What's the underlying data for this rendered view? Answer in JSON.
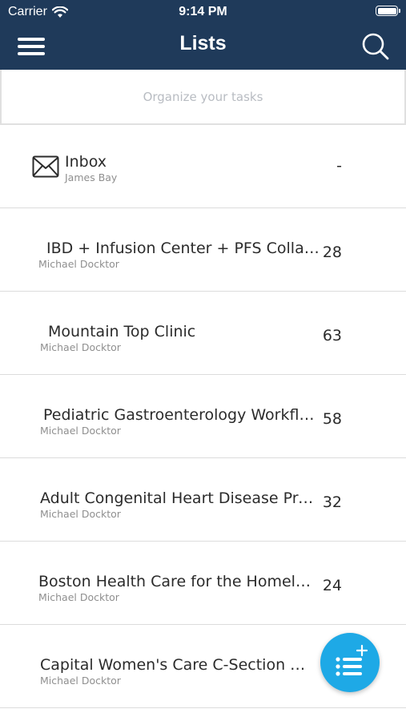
{
  "status_bar": {
    "carrier": "Carrier",
    "time": "9:14 PM"
  },
  "header": {
    "title": "Lists",
    "menu_icon": "hamburger-menu-icon",
    "search_icon": "search-icon",
    "background": "#1f3a5a"
  },
  "search": {
    "placeholder": "Organize your tasks",
    "value": ""
  },
  "lists": [
    {
      "title": "Inbox",
      "owner": "James Bay",
      "count": "-",
      "icon": "envelope-icon"
    },
    {
      "title": "IBD + Infusion Center + PFS Collaborat...",
      "owner": "Michael Docktor",
      "count": "28"
    },
    {
      "title": "Mountain Top Clinic",
      "owner": "Michael Docktor",
      "count": "63"
    },
    {
      "title": "Pediatric Gastroenterology Workflows",
      "owner": "Michael Docktor",
      "count": "58"
    },
    {
      "title": "Adult Congenital Heart Disease Program",
      "owner": "Michael Docktor",
      "count": "32"
    },
    {
      "title": "Boston Health Care for the Homeless P...",
      "owner": "Michael Docktor",
      "count": "24"
    },
    {
      "title": "Capital Women's Care C-Section Workflow",
      "owner": "Michael Docktor",
      "count": ""
    }
  ],
  "fab": {
    "icon": "add-list-icon",
    "color": "#1ea9e6"
  }
}
